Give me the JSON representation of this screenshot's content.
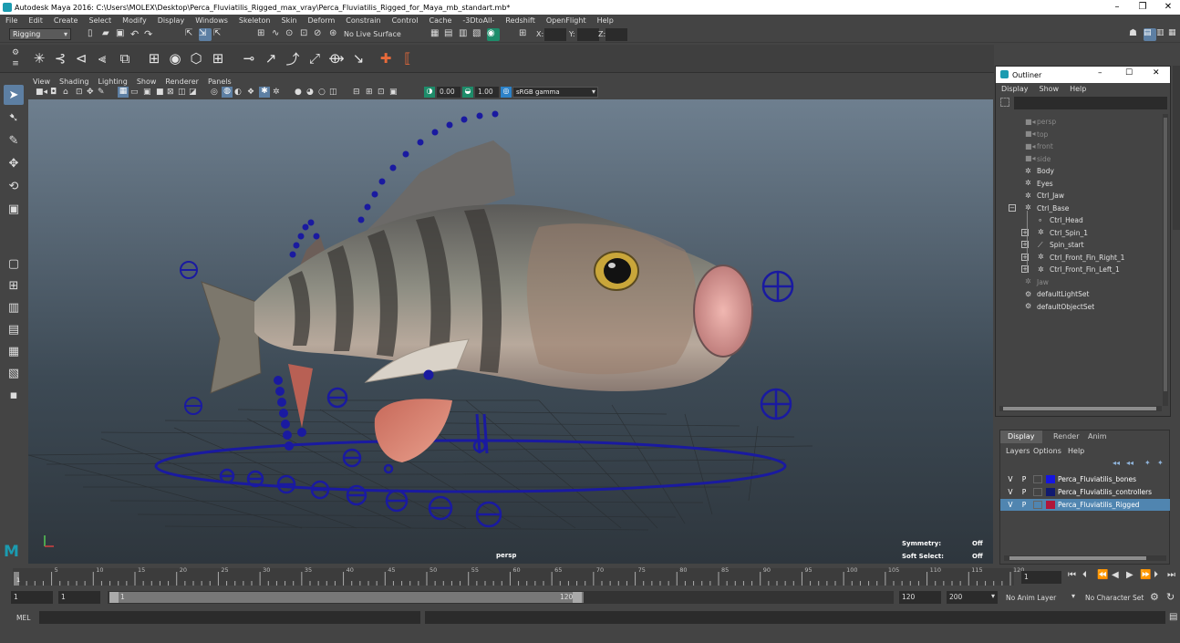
{
  "window": {
    "title": "Autodesk Maya 2016: C:\\Users\\MOLEX\\Desktop\\Perca_Fluviatilis_Rigged_max_vray\\Perca_Fluviatilis_Rigged_for_Maya_mb_standart.mb*",
    "minimize": "–",
    "restore": "❐",
    "close": "✕"
  },
  "menubar": [
    "File",
    "Edit",
    "Create",
    "Select",
    "Modify",
    "Display",
    "Windows",
    "Skeleton",
    "Skin",
    "Deform",
    "Constrain",
    "Control",
    "Cache",
    "-3DtoAll-",
    "Redshift",
    "OpenFlight",
    "Help"
  ],
  "statusline": {
    "mode": "Rigging",
    "live_surface": "No Live Surface",
    "x_label": "X:",
    "y_label": "Y:",
    "z_label": "Z:"
  },
  "viewport": {
    "menus": [
      "View",
      "Shading",
      "Lighting",
      "Show",
      "Renderer",
      "Panels"
    ],
    "field1": "0.00",
    "field2": "1.00",
    "color_space": "sRGB gamma",
    "camera_label": "persp",
    "hud": [
      {
        "label": "Symmetry:",
        "value": "Off"
      },
      {
        "label": "Soft Select:",
        "value": "Off"
      }
    ]
  },
  "outliner": {
    "title": "Outliner",
    "menus": [
      "Display",
      "Show",
      "Help"
    ],
    "items": [
      {
        "label": "persp",
        "dim": true,
        "icon": "camera-icon",
        "indent": 0
      },
      {
        "label": "top",
        "dim": true,
        "icon": "camera-icon",
        "indent": 0
      },
      {
        "label": "front",
        "dim": true,
        "icon": "camera-icon",
        "indent": 0
      },
      {
        "label": "side",
        "dim": true,
        "icon": "camera-icon",
        "indent": 0
      },
      {
        "label": "Body",
        "dim": false,
        "icon": "transform-icon",
        "indent": 0
      },
      {
        "label": "Eyes",
        "dim": false,
        "icon": "transform-icon",
        "indent": 0
      },
      {
        "label": "Ctrl_Jaw",
        "dim": false,
        "icon": "transform-icon",
        "indent": 0
      },
      {
        "label": "Ctrl_Base",
        "dim": false,
        "icon": "transform-icon",
        "indent": 0,
        "expander": "−"
      },
      {
        "label": "Ctrl_Head",
        "dim": false,
        "icon": "joint-icon",
        "indent": 1
      },
      {
        "label": "Ctrl_Spin_1",
        "dim": false,
        "icon": "transform-icon",
        "indent": 1,
        "expander": "+"
      },
      {
        "label": "Spin_start",
        "dim": false,
        "icon": "ik-icon",
        "indent": 1,
        "expander": "+"
      },
      {
        "label": "Ctrl_Front_Fin_Right_1",
        "dim": false,
        "icon": "transform-icon",
        "indent": 1,
        "expander": "+"
      },
      {
        "label": "Ctrl_Front_Fin_Left_1",
        "dim": false,
        "icon": "transform-icon",
        "indent": 1,
        "expander": "+"
      },
      {
        "label": "Jaw",
        "dim": true,
        "icon": "transform-icon",
        "indent": 0
      },
      {
        "label": "defaultLightSet",
        "dim": false,
        "icon": "set-icon",
        "indent": 0
      },
      {
        "label": "defaultObjectSet",
        "dim": false,
        "icon": "set-icon",
        "indent": 0
      }
    ]
  },
  "layer_editor": {
    "tabs": [
      "Display",
      "Render",
      "Anim"
    ],
    "menus": [
      "Layers",
      "Options",
      "Help"
    ],
    "layers": [
      {
        "v": "V",
        "p": "P",
        "color": "#1515e0",
        "name": "Perca_Fluviatilis_bones",
        "selected": false
      },
      {
        "v": "V",
        "p": "P",
        "color": "#101a70",
        "name": "Perca_Fluviatilis_controllers",
        "selected": false
      },
      {
        "v": "V",
        "p": "P",
        "color": "#b0163a",
        "name": "Perca_Fluviatilis_Rigged",
        "selected": true
      }
    ]
  },
  "timeline": {
    "ticks": [
      "1",
      "5",
      "10",
      "15",
      "20",
      "25",
      "30",
      "35",
      "40",
      "45",
      "50",
      "55",
      "60",
      "65",
      "70",
      "75",
      "80",
      "85",
      "90",
      "95",
      "100",
      "105",
      "110",
      "115",
      "120"
    ],
    "current_frame": "1",
    "start": "1",
    "playback_start": "1",
    "range_start": "1",
    "range_end": "120",
    "playback_end": "120",
    "end": "200",
    "anim_layer": "No Anim Layer",
    "character_set": "No Character Set"
  },
  "cmdline": {
    "label": "MEL"
  },
  "colors": {
    "accent": "#2d82c8",
    "controller": "#1a1aa0",
    "selected_layer": "#5085b0"
  }
}
